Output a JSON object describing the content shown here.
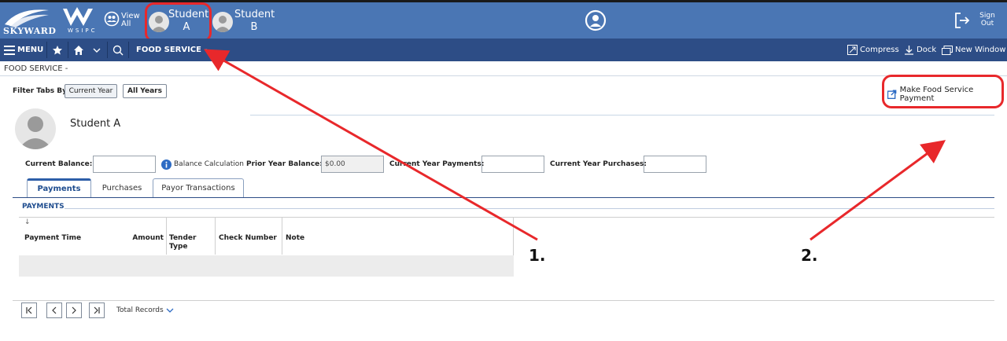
{
  "header": {
    "logo_text": "SKYWARD",
    "logo_sub": "WSIPC",
    "view_all": "View All",
    "students": [
      {
        "line1": "Student",
        "line2": "A"
      },
      {
        "line1": "Student",
        "line2": "B"
      }
    ],
    "sign_out": "Sign Out"
  },
  "nav": {
    "menu": "MENU",
    "page": "FOOD SERVICE -",
    "compress": "Compress",
    "dock": "Dock",
    "new_window": "New Window"
  },
  "breadcrumb": "FOOD SERVICE -",
  "filter": {
    "label": "Filter Tabs By",
    "current_year": "Current Year",
    "all_years": "All Years"
  },
  "make_payment": "Make Food Service Payment",
  "student_name": "Student A",
  "fields": {
    "current_balance": "Current Balance:",
    "balance_calc": "Balance Calculation",
    "prior_year_balance": "Prior Year Balance:",
    "prior_year_value": "$0.00",
    "current_year_payments": "Current Year Payments:",
    "current_year_purchases": "Current Year Purchases:"
  },
  "tabs": [
    "Payments",
    "Purchases",
    "Payor Transactions"
  ],
  "section": "PAYMENTS",
  "table": {
    "sort_arrow": "↓",
    "headers": [
      "Payment Time",
      "Amount",
      "Tender Type",
      "Check Number",
      "Note"
    ]
  },
  "pager": {
    "total_records": "Total Records"
  },
  "annotations": [
    "1.",
    "2."
  ],
  "colors": {
    "topbar": "#4a76b4",
    "navbar": "#2d4d86",
    "highlight": "#e8282b",
    "accent": "#1f4d8f"
  }
}
